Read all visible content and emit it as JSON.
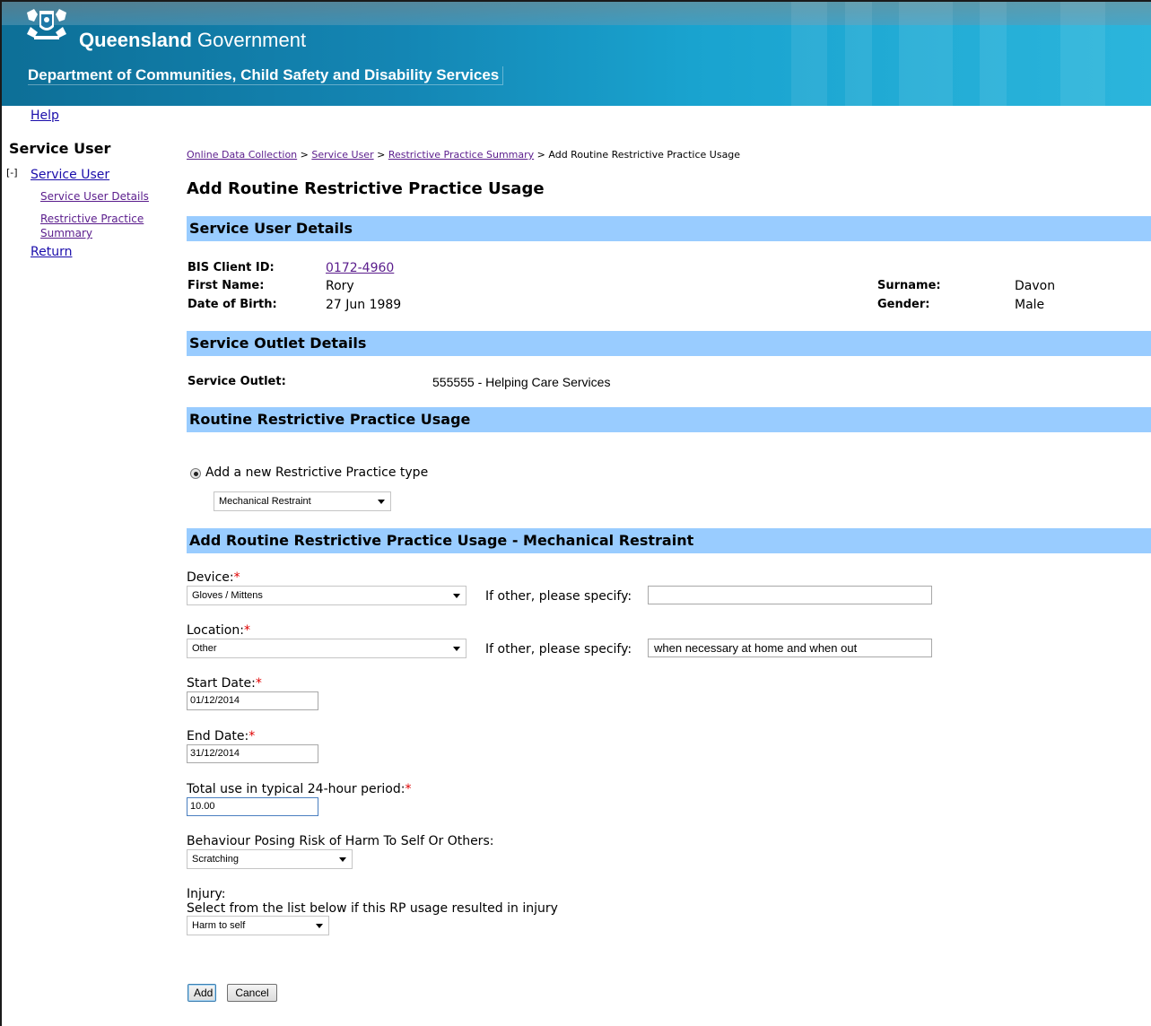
{
  "header": {
    "gov_bold": "Queensland",
    "gov_rest": " Government",
    "department": "Department of Communities, Child Safety and Disability Services"
  },
  "nav": {
    "help": "Help",
    "title": "Service User",
    "toggle": "[-]",
    "service_user": "Service User",
    "service_user_details": "Service User Details",
    "restrictive_practice_summary": "Restrictive Practice Summary",
    "return": "Return"
  },
  "breadcrumb": {
    "items": [
      "Online Data Collection",
      "Service User",
      "Restrictive Practice Summary"
    ],
    "separator": " > ",
    "current": "Add Routine Restrictive Practice Usage"
  },
  "page_title": "Add Routine Restrictive Practice Usage",
  "service_user_section": {
    "heading": "Service User Details",
    "bis_client_id_label": "BIS Client ID:",
    "bis_client_id": "0172-4960",
    "first_name_label": "First Name:",
    "first_name": "Rory",
    "dob_label": "Date of Birth:",
    "dob": "27 Jun 1989",
    "surname_label": "Surname:",
    "surname": "Davon",
    "gender_label": "Gender:",
    "gender": "Male"
  },
  "outlet_section": {
    "heading": "Service Outlet Details",
    "label": "Service Outlet:",
    "value": "555555 - Helping Care Services"
  },
  "usage_section": {
    "heading": "Routine Restrictive Practice Usage",
    "radio_label": "Add a new Restrictive Practice type",
    "type_selected": "Mechanical Restraint"
  },
  "form": {
    "heading": "Add Routine Restrictive Practice Usage - Mechanical Restraint",
    "device_label": "Device:",
    "device_value": "Gloves / Mittens",
    "specify_label": "If other, please specify:",
    "device_other": "",
    "location_label": "Location:",
    "location_value": "Other",
    "location_other": "when necessary at home and when out",
    "start_date_label": "Start Date:",
    "start_date": "01/12/2014",
    "end_date_label": "End Date:",
    "end_date": "31/12/2014",
    "total_use_label": "Total use in typical 24-hour period:",
    "total_use": "10.00",
    "behaviour_label": "Behaviour Posing Risk of Harm To Self Or Others:",
    "behaviour_value": "Scratching",
    "injury_label": "Injury:",
    "injury_hint": "Select from the list below if this RP usage resulted in injury",
    "injury_value": "Harm to self",
    "required_mark": "*",
    "add_button": "Add",
    "cancel_button": "Cancel"
  },
  "colors": {
    "section_bar": "#99ccff",
    "link": "#1a0dab",
    "visited_link": "#5a1c8c",
    "required": "#e00000"
  }
}
